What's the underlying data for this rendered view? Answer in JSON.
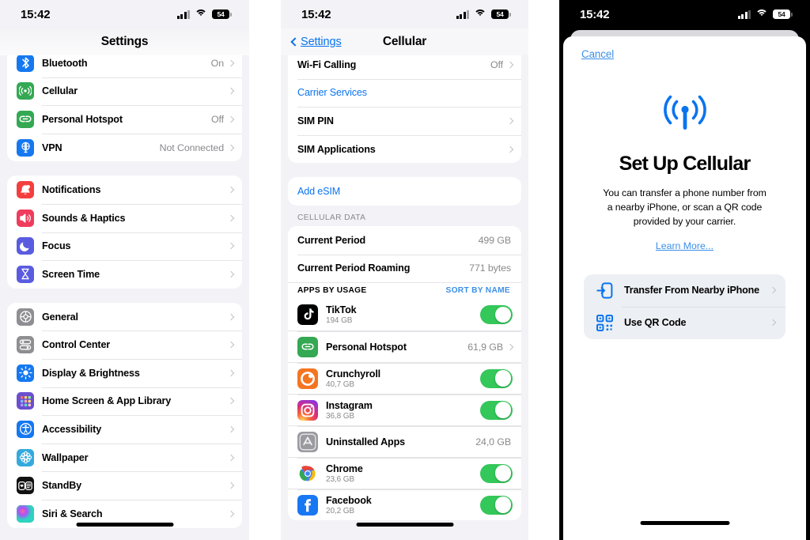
{
  "status_bar": {
    "time": "15:42",
    "battery_percent": "54",
    "signal_icon": "cellular-bars-icon",
    "wifi_icon": "wifi-icon",
    "battery_icon": "battery-icon"
  },
  "panel1": {
    "title": "Settings",
    "groups": [
      {
        "name": "connectivity",
        "rows": [
          {
            "label": "Bluetooth",
            "value": "On",
            "icon": "bluetooth-icon",
            "icon_color": "#1578f0",
            "chevron": true
          },
          {
            "label": "Cellular",
            "value": "",
            "icon": "cellular-antenna-icon",
            "icon_color": "#34a853",
            "chevron": true
          },
          {
            "label": "Personal Hotspot",
            "value": "Off",
            "icon": "hotspot-link-icon",
            "icon_color": "#34a853",
            "chevron": true
          },
          {
            "label": "VPN",
            "value": "Not Connected",
            "icon": "vpn-globe-icon",
            "icon_color": "#1578f0",
            "chevron": true
          }
        ]
      },
      {
        "name": "alerts",
        "rows": [
          {
            "label": "Notifications",
            "value": "",
            "icon": "bell-icon",
            "icon_color": "#f43f3f",
            "chevron": true
          },
          {
            "label": "Sounds & Haptics",
            "value": "",
            "icon": "speaker-icon",
            "icon_color": "#ef3c5c",
            "chevron": true
          },
          {
            "label": "Focus",
            "value": "",
            "icon": "moon-icon",
            "icon_color": "#5a5ce0",
            "chevron": true
          },
          {
            "label": "Screen Time",
            "value": "",
            "icon": "hourglass-icon",
            "icon_color": "#5a5ce0",
            "chevron": true
          }
        ]
      },
      {
        "name": "system",
        "rows": [
          {
            "label": "General",
            "value": "",
            "icon": "gear-icon",
            "icon_color": "#8e8e93",
            "chevron": true
          },
          {
            "label": "Control Center",
            "value": "",
            "icon": "control-center-icon",
            "icon_color": "#8e8e93",
            "chevron": true
          },
          {
            "label": "Display & Brightness",
            "value": "",
            "icon": "brightness-icon",
            "icon_color": "#1578f0",
            "chevron": true
          },
          {
            "label": "Home Screen & App Library",
            "value": "",
            "icon": "home-screen-grid-icon",
            "icon_color": "#6a4fd0",
            "chevron": true
          },
          {
            "label": "Accessibility",
            "value": "",
            "icon": "accessibility-icon",
            "icon_color": "#1578f0",
            "chevron": true
          },
          {
            "label": "Wallpaper",
            "value": "",
            "icon": "wallpaper-flower-icon",
            "icon_color": "#34aadc",
            "chevron": true
          },
          {
            "label": "StandBy",
            "value": "",
            "icon": "standby-icon",
            "icon_color": "#111111",
            "chevron": true
          },
          {
            "label": "Siri & Search",
            "value": "",
            "icon": "siri-icon",
            "icon_color": "#c2417a",
            "chevron": true
          }
        ]
      }
    ]
  },
  "panel2": {
    "back_label": "Settings",
    "title": "Cellular",
    "groups": [
      {
        "name": "sim-settings",
        "rows": [
          {
            "label": "Wi-Fi Calling",
            "value": "Off",
            "chevron": true,
            "link": false
          },
          {
            "label": "Carrier Services",
            "value": "",
            "chevron": false,
            "link": true
          },
          {
            "label": "SIM PIN",
            "value": "",
            "chevron": true,
            "link": false
          },
          {
            "label": "SIM Applications",
            "value": "",
            "chevron": true,
            "link": false
          }
        ]
      },
      {
        "name": "add-esim",
        "rows": [
          {
            "label": "Add eSIM",
            "value": "",
            "chevron": false,
            "link": true
          }
        ]
      }
    ],
    "cellular_data": {
      "section_label": "CELLULAR DATA",
      "rows": [
        {
          "label": "Current Period",
          "value": "499 GB"
        },
        {
          "label": "Current Period Roaming",
          "value": "771 bytes"
        }
      ]
    },
    "apps_by_usage": {
      "header_left": "APPS BY USAGE",
      "header_right": "SORT BY NAME",
      "apps": [
        {
          "name": "TikTok",
          "size": "194 GB",
          "icon": "tiktok-icon",
          "control": "toggle",
          "toggle_on": true
        },
        {
          "name": "Personal Hotspot",
          "size": "",
          "icon": "hotspot-link-icon",
          "control": "value",
          "value": "61,9 GB",
          "chevron": true
        },
        {
          "name": "Crunchyroll",
          "size": "40,7 GB",
          "icon": "crunchyroll-icon",
          "control": "toggle",
          "toggle_on": true
        },
        {
          "name": "Instagram",
          "size": "36,8 GB",
          "icon": "instagram-icon",
          "control": "toggle",
          "toggle_on": true
        },
        {
          "name": "Uninstalled Apps",
          "size": "",
          "icon": "app-store-icon",
          "control": "value",
          "value": "24,0 GB",
          "chevron": false
        },
        {
          "name": "Chrome",
          "size": "23,6 GB",
          "icon": "chrome-icon",
          "control": "toggle",
          "toggle_on": true
        },
        {
          "name": "Facebook",
          "size": "20,2 GB",
          "icon": "facebook-icon",
          "control": "toggle",
          "toggle_on": true
        }
      ]
    }
  },
  "panel3": {
    "cancel_label": "Cancel",
    "hero_icon": "cellular-broadcast-icon",
    "title": "Set Up Cellular",
    "description": "You can transfer a phone number from a nearby iPhone, or scan a QR code provided by your carrier.",
    "learn_more_label": "Learn More...",
    "options": [
      {
        "label": "Transfer From Nearby iPhone",
        "icon": "transfer-iphone-icon",
        "chevron": true
      },
      {
        "label": "Use QR Code",
        "icon": "qr-code-icon",
        "chevron": true
      }
    ]
  },
  "colors": {
    "ios_blue": "#0a74ef",
    "link_blue": "#3b8fe8",
    "toggle_green": "#34c759",
    "group_bg": "#ffffff",
    "page_bg": "#f2f2f7",
    "secondary_text": "#8a8a8e"
  }
}
